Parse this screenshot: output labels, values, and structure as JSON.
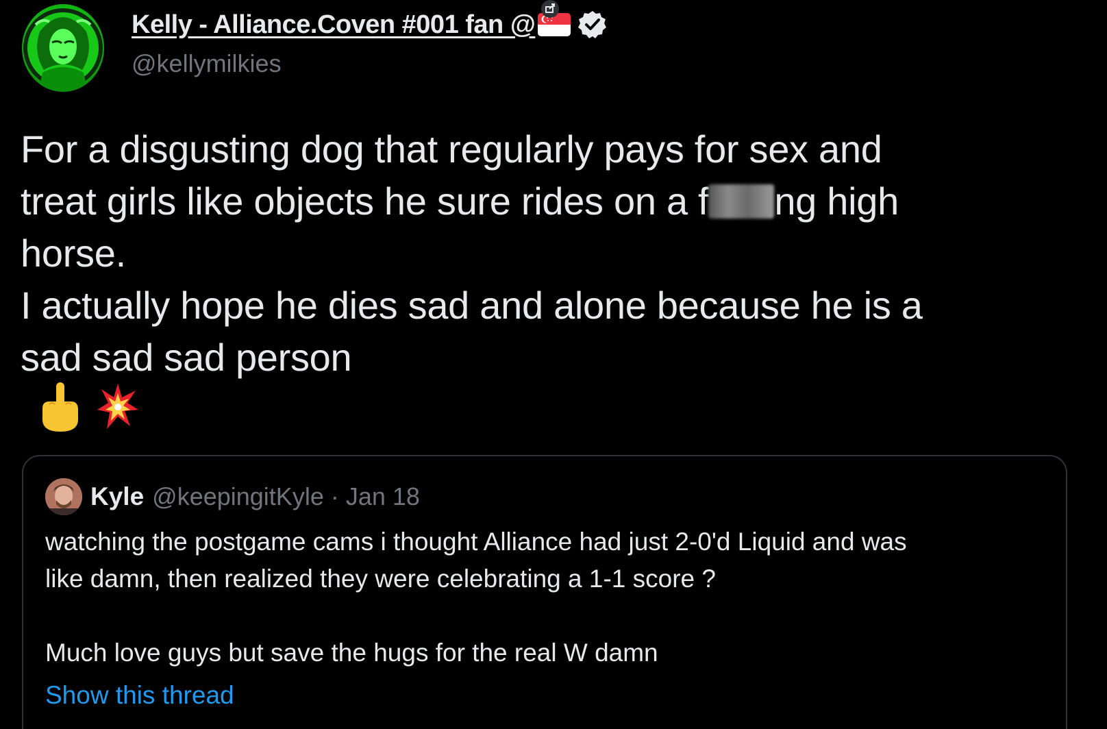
{
  "tweet": {
    "display_name": "Kelly - Alliance.Coven #001 fan @",
    "handle": "@kellymilkies",
    "avatar_icon": "avatar-green-portrait",
    "flag_icon": "singapore-flag-icon",
    "verified_icon": "verified-badge-icon",
    "text_lines": [
      "For a disgusting dog that regularly pays for sex and",
      "treat girls like objects he sure rides on a f",
      "ng high",
      "horse.",
      "I actually hope he dies sad and alone because he is a",
      "sad sad sad person"
    ],
    "emojis": [
      "middle-finger-emoji",
      "collision-emoji"
    ]
  },
  "quote": {
    "name": "Kyle",
    "handle": "@keepingitKyle",
    "separator": " · ",
    "date": "Jan 18",
    "meta": "@keepingitKyle · Jan 18",
    "lines": [
      "watching the postgame cams i thought Alliance had just 2-0'd Liquid and was",
      "like damn, then realized they were celebrating a 1-1 score ?",
      "Much love guys but save the hugs for the real W damn"
    ],
    "show_thread": "Show this thread"
  },
  "colors": {
    "background": "#000000",
    "text": "#e7e9ea",
    "secondary": "#71767b",
    "link": "#1d9bf0",
    "border": "#2f3336",
    "avatar_green": "#16d616"
  }
}
